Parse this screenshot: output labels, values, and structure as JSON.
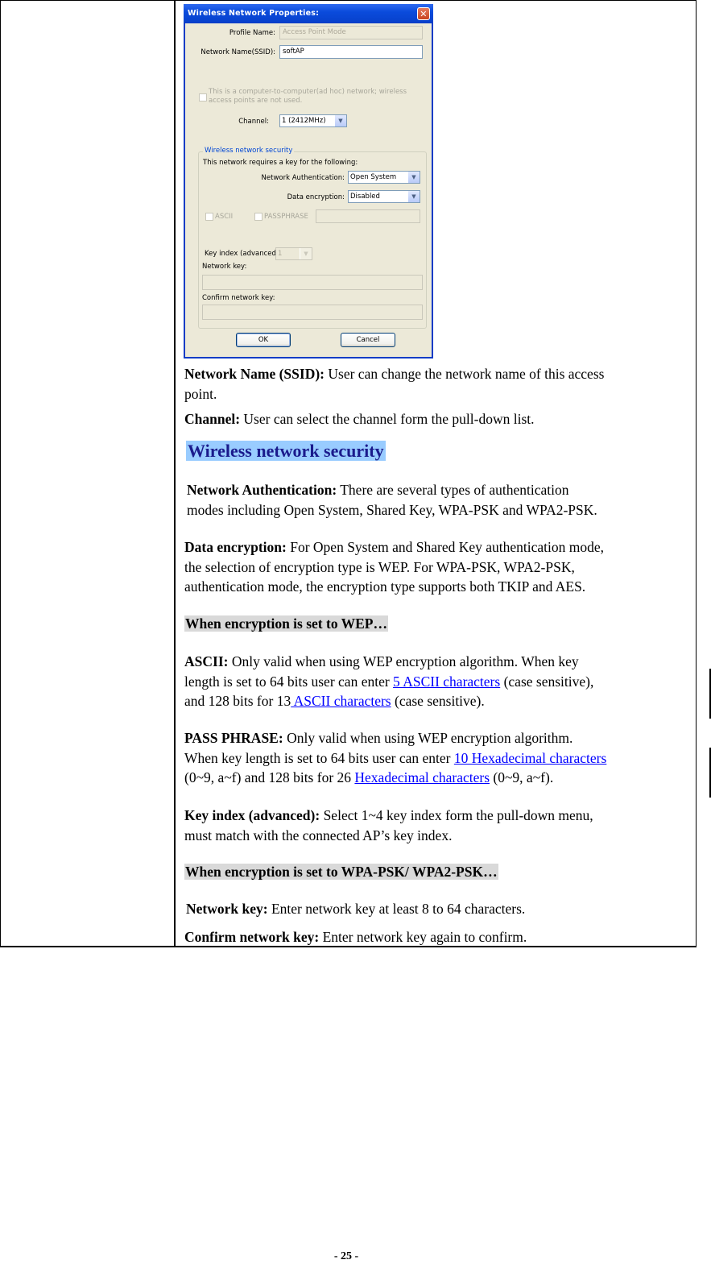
{
  "dialog": {
    "title": "Wireless Network Properties:",
    "close_icon": "close-x-icon",
    "profile_name_label": "Profile Name:",
    "profile_name_value": "Access Point Mode",
    "ssid_label": "Network Name(SSID):",
    "ssid_value": "softAP",
    "adhoc_checkbox_label_line1": "This is a computer-to-computer(ad hoc) network; wireless",
    "adhoc_checkbox_label_line2": "access points are not used.",
    "adhoc_checked": false,
    "channel_label": "Channel:",
    "channel_value": "1  (2412MHz)",
    "security_group_title": "Wireless network security",
    "security_intro": "This network requires a key for the following:",
    "auth_label": "Network Authentication:",
    "auth_value": "Open System",
    "encryption_label": "Data encryption:",
    "encryption_value": "Disabled",
    "ascii_label": "ASCII",
    "passphrase_label": "PASSPHRASE",
    "key_index_label": "Key index (advanced):",
    "key_index_value": "1",
    "network_key_label": "Network key:",
    "confirm_key_label": "Confirm network key:",
    "ok_label": "OK",
    "cancel_label": "Cancel"
  },
  "descriptions": {
    "ssid": {
      "term": "Network Name (SSID):",
      "text_line1": " User can change the network name of this access",
      "text_line2": "point."
    },
    "channel": {
      "term": "Channel:",
      "text": " User can select the channel form the pull-down list."
    },
    "security_heading": "Wireless network security",
    "auth": {
      "term": "Network Authentication:",
      "text_line1": " There are several types of authentication",
      "text_line2": "modes including Open System, Shared Key, WPA-PSK and WPA2-PSK."
    },
    "encryption": {
      "term": "Data encryption:",
      "text_line1": " For Open System and Shared Key authentication mode,",
      "text_line2": "the selection of encryption type is WEP. For WPA-PSK, WPA2-PSK,",
      "text_line3": "authentication mode, the encryption type supports both TKIP and AES."
    },
    "wep_heading": "When encryption is set to WEP…",
    "ascii": {
      "term": "ASCII:",
      "text_line1": " Only valid when using WEP encryption algorithm. When key",
      "text_line2_pre": "length is set to 64 bits user can enter ",
      "link1": "5 ASCII characters",
      "text_line2_post": " (case sensitive),",
      "text_line3_pre": "and 128 bits for 13",
      "link2": " ASCII characters",
      "text_line3_post": " (case sensitive)."
    },
    "passphrase": {
      "term": "PASS PHRASE:",
      "text_line1": " Only valid when using WEP encryption algorithm.",
      "text_line2_pre": "When key length is set to 64 bits user can enter ",
      "link1": "10 Hexadecimal characters",
      "text_line3_pre": "(0~9, a~f) and 128 bits for 26 ",
      "link2": "Hexadecimal characters",
      "text_line3_post": " (0~9, a~f)."
    },
    "key_index": {
      "term": "Key index (advanced):",
      "text_line1": " Select 1~4 key index form the pull-down menu,",
      "text_line2": "must match with the connected AP’s key index."
    },
    "wpa_heading": "When encryption is set to WPA-PSK/ WPA2-PSK…",
    "network_key": {
      "term": "Network key:",
      "text": " Enter network key at least 8 to 64 characters."
    },
    "confirm_key": {
      "term": "Confirm network key:",
      "text": " Enter network key again to confirm."
    }
  },
  "footer": {
    "page_number": "- 25 -"
  }
}
